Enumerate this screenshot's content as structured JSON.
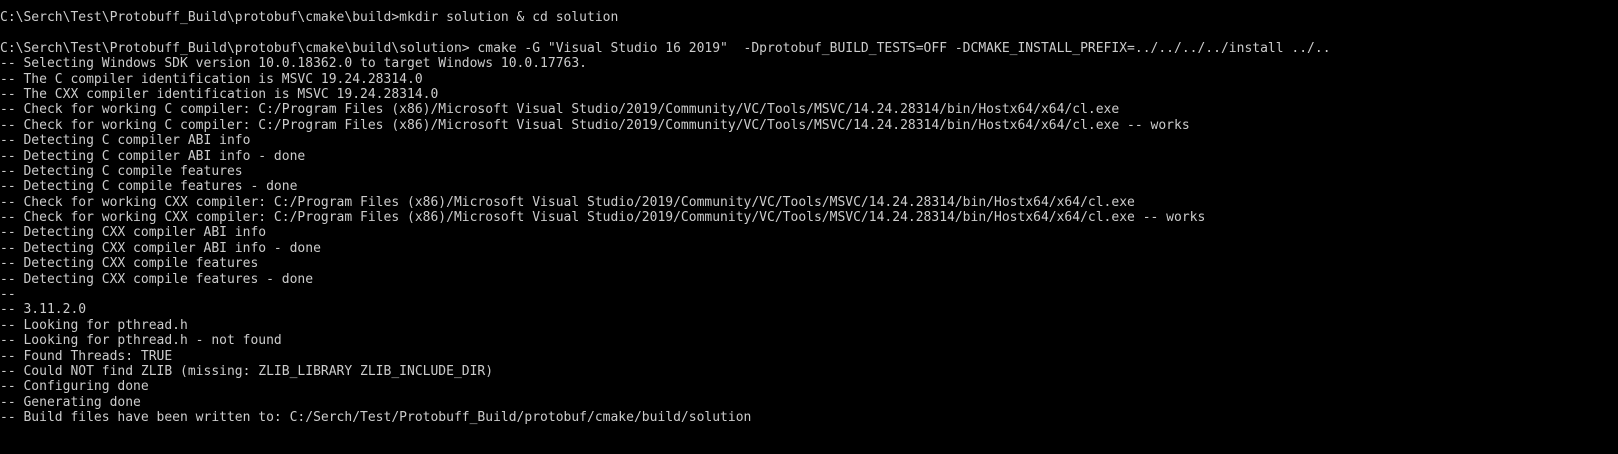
{
  "lines": [
    "C:\\Serch\\Test\\Protobuff_Build\\protobuf\\cmake\\build>mkdir solution & cd solution",
    "",
    "C:\\Serch\\Test\\Protobuff_Build\\protobuf\\cmake\\build\\solution> cmake -G \"Visual Studio 16 2019\"  -Dprotobuf_BUILD_TESTS=OFF -DCMAKE_INSTALL_PREFIX=../../../../install ../..",
    "-- Selecting Windows SDK version 10.0.18362.0 to target Windows 10.0.17763.",
    "-- The C compiler identification is MSVC 19.24.28314.0",
    "-- The CXX compiler identification is MSVC 19.24.28314.0",
    "-- Check for working C compiler: C:/Program Files (x86)/Microsoft Visual Studio/2019/Community/VC/Tools/MSVC/14.24.28314/bin/Hostx64/x64/cl.exe",
    "-- Check for working C compiler: C:/Program Files (x86)/Microsoft Visual Studio/2019/Community/VC/Tools/MSVC/14.24.28314/bin/Hostx64/x64/cl.exe -- works",
    "-- Detecting C compiler ABI info",
    "-- Detecting C compiler ABI info - done",
    "-- Detecting C compile features",
    "-- Detecting C compile features - done",
    "-- Check for working CXX compiler: C:/Program Files (x86)/Microsoft Visual Studio/2019/Community/VC/Tools/MSVC/14.24.28314/bin/Hostx64/x64/cl.exe",
    "-- Check for working CXX compiler: C:/Program Files (x86)/Microsoft Visual Studio/2019/Community/VC/Tools/MSVC/14.24.28314/bin/Hostx64/x64/cl.exe -- works",
    "-- Detecting CXX compiler ABI info",
    "-- Detecting CXX compiler ABI info - done",
    "-- Detecting CXX compile features",
    "-- Detecting CXX compile features - done",
    "--",
    "-- 3.11.2.0",
    "-- Looking for pthread.h",
    "-- Looking for pthread.h - not found",
    "-- Found Threads: TRUE",
    "-- Could NOT find ZLIB (missing: ZLIB_LIBRARY ZLIB_INCLUDE_DIR)",
    "-- Configuring done",
    "-- Generating done",
    "-- Build files have been written to: C:/Serch/Test/Protobuff_Build/protobuf/cmake/build/solution"
  ]
}
